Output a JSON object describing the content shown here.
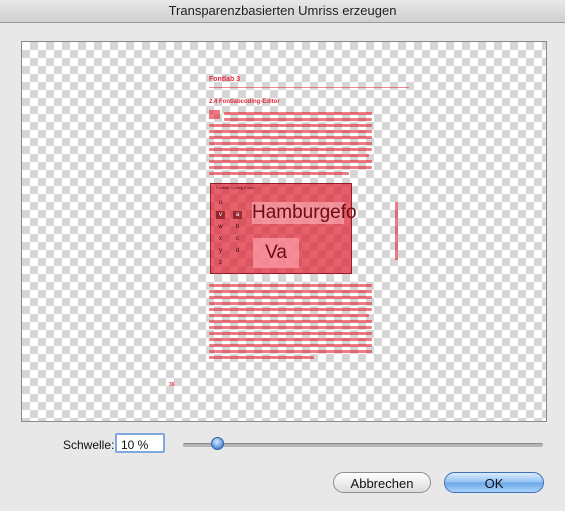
{
  "window": {
    "title": "Transparenzbasierten Umriss erzeugen"
  },
  "preview": {
    "chapter_heading": "Fontlab 3",
    "section_heading": "2.4  Fontlabcoding-Editor",
    "panel_word": "Hamburgefo",
    "panel_glyph": "Va",
    "letters": [
      "u",
      "v",
      "w",
      "x",
      "y",
      "z"
    ],
    "letters2": [
      "a",
      "b",
      "c",
      "d"
    ],
    "page_number": "36"
  },
  "threshold": {
    "label": "Schwelle:",
    "value": "10 %",
    "slider_fraction": 0.1
  },
  "buttons": {
    "cancel": "Abbrechen",
    "ok": "OK"
  },
  "colors": {
    "overlay": "#e52a3a",
    "accent": "#4d8ee0"
  }
}
